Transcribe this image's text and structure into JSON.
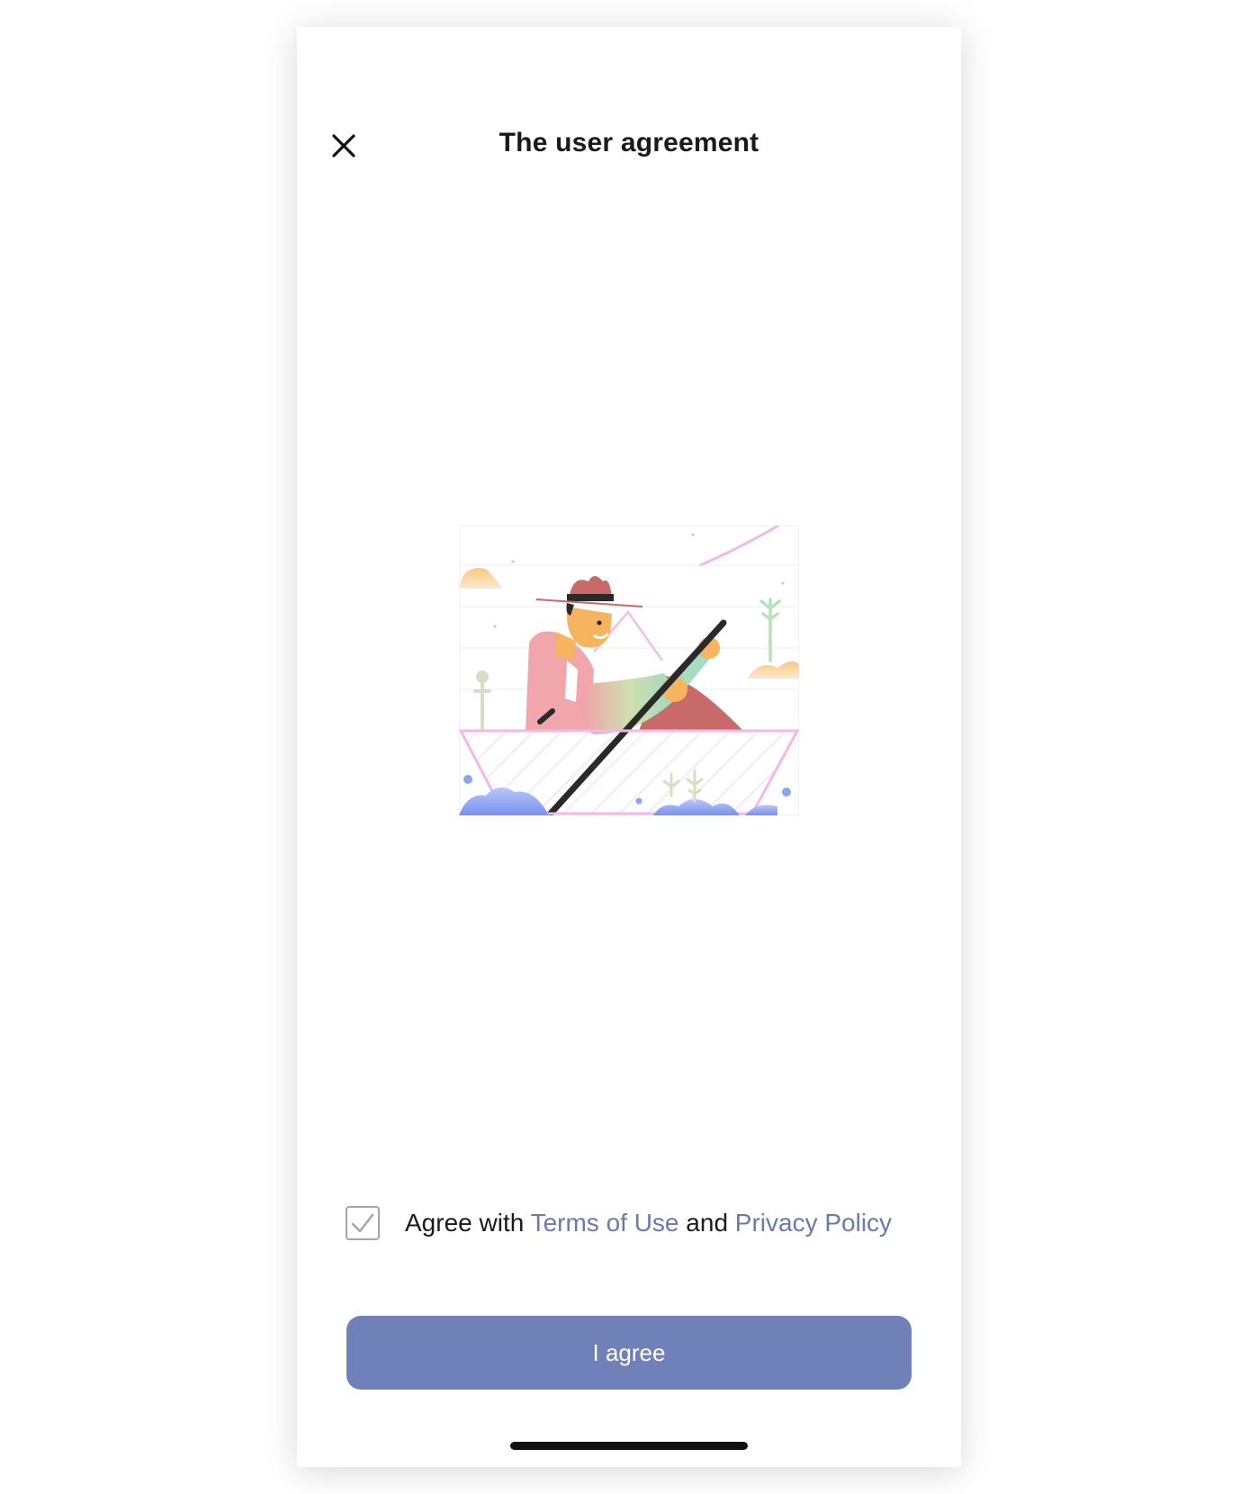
{
  "header": {
    "close_icon": "close-icon",
    "title": "The user agreement"
  },
  "illustration": {
    "icon": "person-rowing-boat-illustration"
  },
  "agreement": {
    "checked": true,
    "prefix": "Agree with",
    "terms_link": "Terms of Use",
    "conjunction": "and",
    "privacy_link": "Privacy Policy"
  },
  "primary_button": {
    "label": "I agree"
  },
  "colors": {
    "accent": "#7080b8",
    "link": "#6a78b4"
  }
}
